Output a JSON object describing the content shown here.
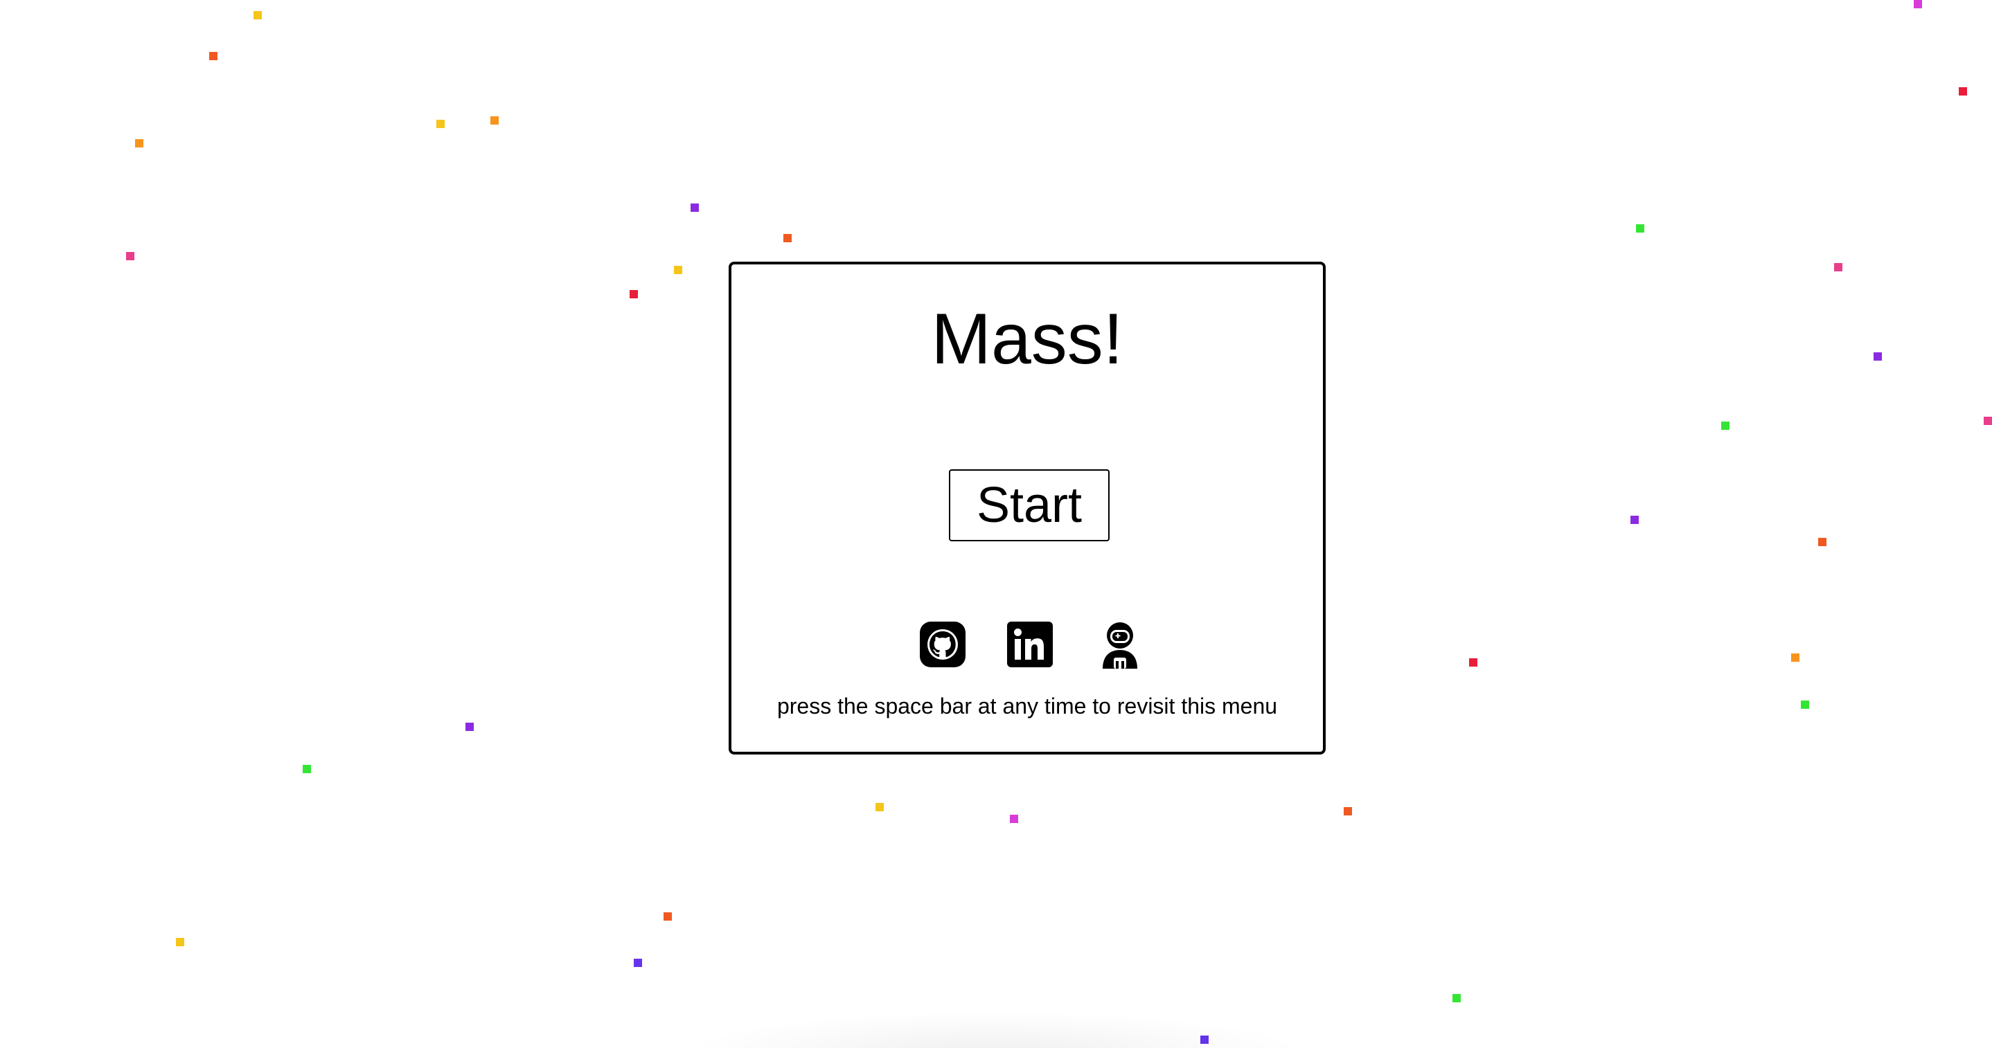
{
  "menu": {
    "title": "Mass!",
    "start_label": "Start",
    "hint": "press the space bar at any time to revisit this menu",
    "links": [
      {
        "name": "github-icon"
      },
      {
        "name": "linkedin-icon"
      },
      {
        "name": "astronaut-icon"
      }
    ]
  },
  "particle_colors": [
    "#f5c518",
    "#f05a22",
    "#f7941d",
    "#8a2be2",
    "#e83e8c",
    "#e81e3a",
    "#33e633",
    "#6633ee",
    "#d93bd9"
  ]
}
